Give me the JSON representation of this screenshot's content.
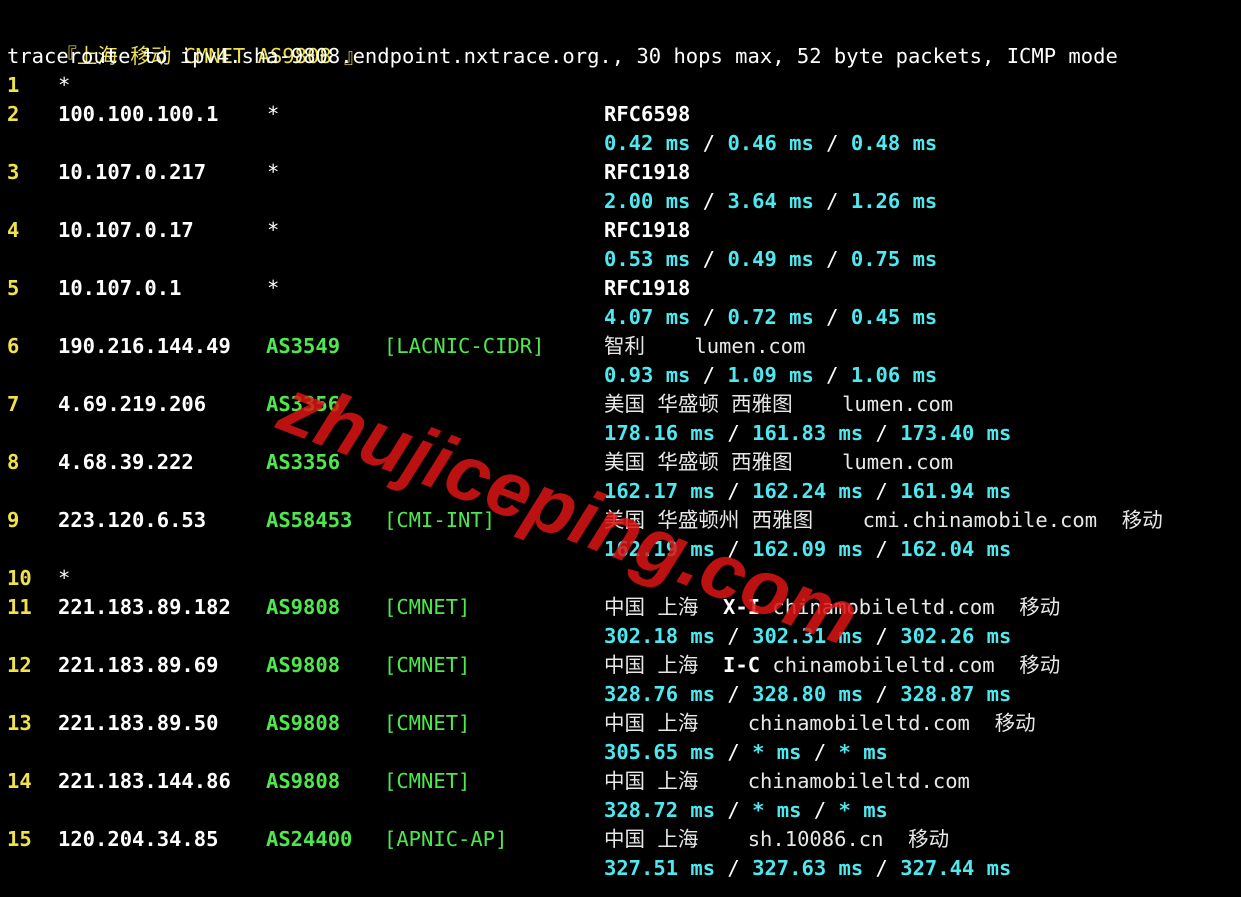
{
  "title": {
    "prefix": "『上海 移动 ",
    "bold": "CMNET AS9808",
    "suffix": " 』"
  },
  "header": "traceroute to ipv4.sha-9808.endpoint.nxtrace.org., 30 hops max, 52 byte packets, ICMP mode",
  "hops": [
    {
      "n": "1",
      "ip": "*",
      "star": "",
      "asn": "",
      "tag": "",
      "rfc": "",
      "geo": "",
      "geo_bold": "",
      "host": "",
      "carrier": "",
      "rtt": []
    },
    {
      "n": "2",
      "ip": "100.100.100.1",
      "star": "*",
      "asn": "",
      "tag": "",
      "rfc": "RFC6598",
      "geo": "",
      "geo_bold": "",
      "host": "",
      "carrier": "",
      "rtt": [
        "0.42 ms",
        "0.46 ms",
        "0.48 ms"
      ]
    },
    {
      "n": "3",
      "ip": "10.107.0.217",
      "star": "*",
      "asn": "",
      "tag": "",
      "rfc": "RFC1918",
      "geo": "",
      "geo_bold": "",
      "host": "",
      "carrier": "",
      "rtt": [
        "2.00 ms",
        "3.64 ms",
        "1.26 ms"
      ]
    },
    {
      "n": "4",
      "ip": "10.107.0.17",
      "star": "*",
      "asn": "",
      "tag": "",
      "rfc": "RFC1918",
      "geo": "",
      "geo_bold": "",
      "host": "",
      "carrier": "",
      "rtt": [
        "0.53 ms",
        "0.49 ms",
        "0.75 ms"
      ]
    },
    {
      "n": "5",
      "ip": "10.107.0.1",
      "star": "*",
      "asn": "",
      "tag": "",
      "rfc": "RFC1918",
      "geo": "",
      "geo_bold": "",
      "host": "",
      "carrier": "",
      "rtt": [
        "4.07 ms",
        "0.72 ms",
        "0.45 ms"
      ]
    },
    {
      "n": "6",
      "ip": "190.216.144.49",
      "star": "",
      "asn": "AS3549",
      "tag": "[LACNIC-CIDR]",
      "rfc": "",
      "geo": "智利",
      "geo_bold": "",
      "host": "lumen.com",
      "carrier": "",
      "rtt": [
        "0.93 ms",
        "1.09 ms",
        "1.06 ms"
      ]
    },
    {
      "n": "7",
      "ip": "4.69.219.206",
      "star": "",
      "asn": "AS3356",
      "tag": "",
      "rfc": "",
      "geo": "美国 华盛顿 西雅图",
      "geo_bold": "",
      "host": "lumen.com",
      "carrier": "",
      "rtt": [
        "178.16 ms",
        "161.83 ms",
        "173.40 ms"
      ]
    },
    {
      "n": "8",
      "ip": "4.68.39.222",
      "star": "",
      "asn": "AS3356",
      "tag": "",
      "rfc": "",
      "geo": "美国 华盛顿 西雅图",
      "geo_bold": "",
      "host": "lumen.com",
      "carrier": "",
      "rtt": [
        "162.17 ms",
        "162.24 ms",
        "161.94 ms"
      ]
    },
    {
      "n": "9",
      "ip": "223.120.6.53",
      "star": "",
      "asn": "AS58453",
      "tag": "[CMI-INT]",
      "rfc": "",
      "geo": "美国 华盛顿州 西雅图",
      "geo_bold": "",
      "host": "cmi.chinamobile.com",
      "carrier": "移动",
      "rtt": [
        "162.19 ms",
        "162.09 ms",
        "162.04 ms"
      ]
    },
    {
      "n": "10",
      "ip": "*",
      "star": "",
      "asn": "",
      "tag": "",
      "rfc": "",
      "geo": "",
      "geo_bold": "",
      "host": "",
      "carrier": "",
      "rtt": []
    },
    {
      "n": "11",
      "ip": "221.183.89.182",
      "star": "",
      "asn": "AS9808",
      "tag": "[CMNET]",
      "rfc": "",
      "geo": "中国 上海",
      "geo_bold": "X-I",
      "host": "chinamobileltd.com",
      "carrier": "移动",
      "rtt": [
        "302.18 ms",
        "302.31 ms",
        "302.26 ms"
      ]
    },
    {
      "n": "12",
      "ip": "221.183.89.69",
      "star": "",
      "asn": "AS9808",
      "tag": "[CMNET]",
      "rfc": "",
      "geo": "中国 上海",
      "geo_bold": "I-C",
      "host": "chinamobileltd.com",
      "carrier": "移动",
      "rtt": [
        "328.76 ms",
        "328.80 ms",
        "328.87 ms"
      ]
    },
    {
      "n": "13",
      "ip": "221.183.89.50",
      "star": "",
      "asn": "AS9808",
      "tag": "[CMNET]",
      "rfc": "",
      "geo": "中国 上海",
      "geo_bold": "",
      "host": "chinamobileltd.com",
      "carrier": "移动",
      "rtt": [
        "305.65 ms",
        "* ms",
        "* ms"
      ]
    },
    {
      "n": "14",
      "ip": "221.183.144.86",
      "star": "",
      "asn": "AS9808",
      "tag": "[CMNET]",
      "rfc": "",
      "geo": "中国 上海",
      "geo_bold": "",
      "host": "chinamobileltd.com",
      "carrier": "",
      "rtt": [
        "328.72 ms",
        "* ms",
        "* ms"
      ]
    },
    {
      "n": "15",
      "ip": "120.204.34.85",
      "star": "",
      "asn": "AS24400",
      "tag": "[APNIC-AP]",
      "rfc": "",
      "geo": "中国 上海",
      "geo_bold": "",
      "host": "sh.10086.cn",
      "carrier": "移动",
      "rtt": [
        "327.51 ms",
        "327.63 ms",
        "327.44 ms"
      ]
    }
  ],
  "rtt_separator": " / ",
  "watermark": "zhujiceping.com",
  "colors": {
    "background": "#000000",
    "hop_number": "#f0e24a",
    "asn": "#4ee84e",
    "rtt": "#4ee8f0",
    "watermark": "#dc1414"
  }
}
